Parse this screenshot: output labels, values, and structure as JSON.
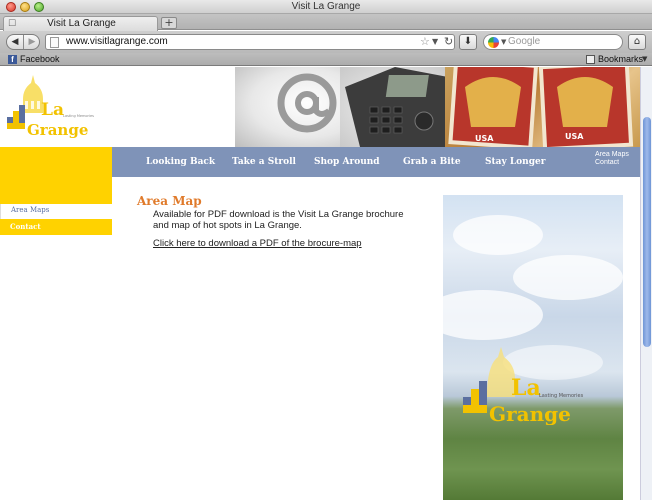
{
  "window": {
    "title": "Visit La Grange"
  },
  "tab": {
    "label": "Visit La Grange",
    "new_tab_label": "+"
  },
  "toolbar": {
    "url": "www.visitlagrange.com",
    "search_placeholder": "Google"
  },
  "bookmarks": {
    "facebook_label": "Facebook",
    "bookmarks_label": "Bookmarks"
  },
  "site": {
    "logo_text": "La Grange",
    "logo_tagline": "Lasting Memories",
    "nav": [
      "Looking Back",
      "Take a Stroll",
      "Shop Around",
      "Grab a Bite",
      "Stay Longer"
    ],
    "side_links": [
      "Area Maps",
      "Contact"
    ],
    "subnav": {
      "active": "Area Maps",
      "item": "Contact"
    },
    "content": {
      "title": "Area Map",
      "body": "Available for PDF download is the Visit La Grange brochure and map of hot spots in La Grange.",
      "link": "Click here to download a PDF of the brocure-map"
    }
  },
  "colors": {
    "accent_yellow": "#ffd200",
    "nav_blue": "#7f93b8",
    "title_orange": "#e07a2a"
  }
}
